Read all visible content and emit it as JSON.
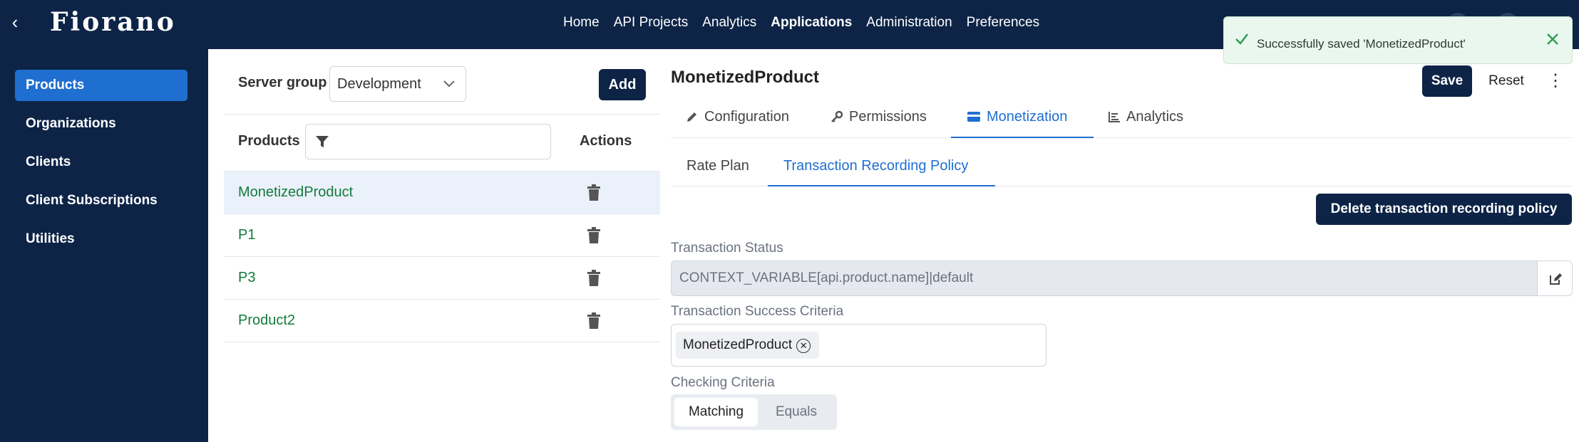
{
  "header": {
    "back_glyph": "‹",
    "logo": "Fiorano",
    "nav": [
      "Home",
      "API Projects",
      "Analytics",
      "Applications",
      "Administration",
      "Preferences"
    ],
    "active_nav": "Applications"
  },
  "sidebar": {
    "items": [
      {
        "label": "Products"
      },
      {
        "label": "Organizations"
      },
      {
        "label": "Clients"
      },
      {
        "label": "Client Subscriptions"
      },
      {
        "label": "Utilities"
      }
    ],
    "active": "Products"
  },
  "list_panel": {
    "server_group_label": "Server group",
    "server_group_value": "Development",
    "add_label": "Add",
    "products_label": "Products",
    "filter_placeholder": "",
    "actions_label": "Actions",
    "rows": [
      "MonetizedProduct",
      "P1",
      "P3",
      "Product2"
    ],
    "selected_row": "MonetizedProduct"
  },
  "detail": {
    "title": "MonetizedProduct",
    "save_label": "Save",
    "reset_label": "Reset",
    "tabs": [
      "Configuration",
      "Permissions",
      "Monetization",
      "Analytics"
    ],
    "active_tab": "Monetization",
    "subtabs": [
      "Rate Plan",
      "Transaction Recording Policy"
    ],
    "active_subtab": "Transaction Recording Policy",
    "delete_policy_label": "Delete transaction recording policy",
    "transaction_status_label": "Transaction Status",
    "transaction_status_value": "CONTEXT_VARIABLE[api.product.name]|default",
    "success_criteria_label": "Transaction Success Criteria",
    "success_criteria_chip": "MonetizedProduct",
    "checking_criteria_label": "Checking Criteria",
    "checking_options": [
      "Matching",
      "Equals"
    ],
    "checking_selected": "Matching"
  },
  "toast": {
    "message": "Successfully saved 'MonetizedProduct'",
    "type": "success"
  },
  "colors": {
    "navy": "#0d2447",
    "accent_blue": "#1f6fd1",
    "product_green": "#157a3b",
    "toast_bg": "#eaf7ee"
  }
}
